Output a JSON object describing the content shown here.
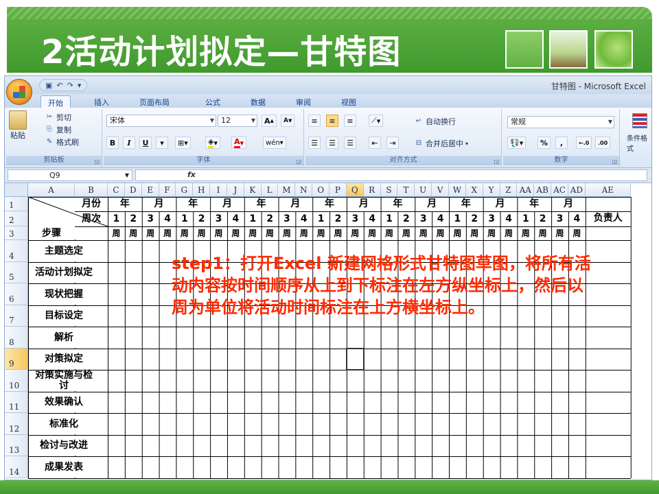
{
  "slide": {
    "title": "2活动计划拟定—甘特图",
    "instruction": "step1：打开Excel 新建网格形式甘特图草图，将所有活动内容按时间顺序从上到下标注在左方纵坐标上，然后以周为单位将活动时间标注在上方横坐标上。",
    "accent_color": "#4ea83a",
    "instruction_color": "#ff2a00"
  },
  "excel": {
    "window_title": "甘特图 - Microsoft Excel",
    "tabs": [
      "开始",
      "插入",
      "页面布局",
      "公式",
      "数据",
      "审阅",
      "视图"
    ],
    "active_tab": "开始",
    "clipboard": {
      "paste": "粘贴",
      "cut": "剪切",
      "copy": "复制",
      "format_painter": "格式刷",
      "group": "剪贴板"
    },
    "font": {
      "name": "宋体",
      "size": "12",
      "bold": "B",
      "italic": "I",
      "underline": "U",
      "grow": "A",
      "shrink": "A",
      "group": "字体"
    },
    "alignment": {
      "wrap": "自动换行",
      "merge": "合并后居中",
      "group": "对齐方式"
    },
    "number": {
      "format": "常规",
      "percent": "%",
      "comma": ",",
      "group": "数字"
    },
    "styles": {
      "conditional": "条件格式"
    },
    "name_box": "Q9",
    "fx": "fx",
    "selected_cell": "Q9"
  },
  "sheet": {
    "columns": [
      "A",
      "B",
      "C",
      "D",
      "E",
      "F",
      "G",
      "H",
      "I",
      "J",
      "K",
      "L",
      "M",
      "N",
      "O",
      "P",
      "Q",
      "R",
      "S",
      "T",
      "U",
      "V",
      "W",
      "X",
      "Y",
      "Z",
      "AA",
      "AB",
      "AC",
      "AD",
      "AE"
    ],
    "rows": [
      "1",
      "2",
      "3",
      "4",
      "5",
      "6",
      "7",
      "8",
      "9",
      "10",
      "11",
      "12",
      "13",
      "14"
    ],
    "header_month": "月份",
    "header_week": "周次",
    "header_steps": "步骤",
    "header_owner": "负责人",
    "month_year_pairs": [
      "年",
      "月",
      "年",
      "月",
      "年",
      "月",
      "年",
      "月",
      "年",
      "月",
      "年",
      "月",
      "年",
      "月"
    ],
    "week_numbers": [
      "1",
      "2",
      "3",
      "4",
      "1",
      "2",
      "3",
      "4",
      "1",
      "2",
      "3",
      "4",
      "1",
      "2",
      "3",
      "4",
      "1",
      "2",
      "3",
      "4",
      "1",
      "2",
      "3",
      "4",
      "1",
      "2",
      "3",
      "4"
    ],
    "week_unit": "周",
    "tasks": [
      "主题选定",
      "活动计划拟定",
      "现状把握",
      "目标设定",
      "解析",
      "对策拟定",
      "对策实施与检讨",
      "效果确认",
      "标准化",
      "检讨与改进",
      "成果发表"
    ]
  }
}
